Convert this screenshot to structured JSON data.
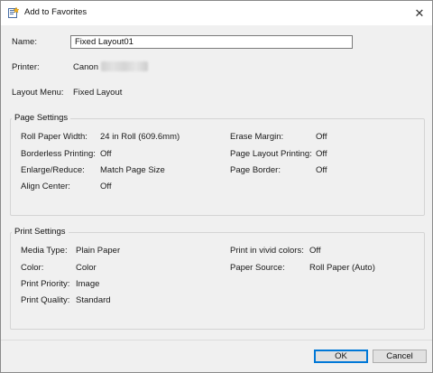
{
  "window": {
    "title": "Add to Favorites",
    "close_glyph": "✕",
    "icon": "favorites-icon"
  },
  "name": {
    "label": "Name:",
    "value": "Fixed Layout01"
  },
  "printer": {
    "label": "Printer:",
    "value": "Canon"
  },
  "layout_menu": {
    "label": "Layout Menu:",
    "value": "Fixed Layout"
  },
  "page_settings": {
    "title": "Page Settings",
    "roll_paper_width": {
      "label": "Roll Paper Width:",
      "value": "24 in Roll (609.6mm)"
    },
    "borderless_printing": {
      "label": "Borderless Printing:",
      "value": "Off"
    },
    "enlarge_reduce": {
      "label": "Enlarge/Reduce:",
      "value": "Match Page Size"
    },
    "align_center": {
      "label": "Align Center:",
      "value": "Off"
    },
    "erase_margin": {
      "label": "Erase Margin:",
      "value": "Off"
    },
    "page_layout_printing": {
      "label": "Page Layout Printing:",
      "value": "Off"
    },
    "page_border": {
      "label": "Page Border:",
      "value": "Off"
    }
  },
  "print_settings": {
    "title": "Print Settings",
    "media_type": {
      "label": "Media Type:",
      "value": "Plain Paper"
    },
    "color": {
      "label": "Color:",
      "value": "Color"
    },
    "print_priority": {
      "label": "Print Priority:",
      "value": "Image"
    },
    "print_quality": {
      "label": "Print Quality:",
      "value": "Standard"
    },
    "vivid_colors": {
      "label": "Print in vivid colors:",
      "value": "Off"
    },
    "paper_source": {
      "label": "Paper Source:",
      "value": "Roll Paper (Auto)"
    }
  },
  "buttons": {
    "ok": "OK",
    "cancel": "Cancel"
  },
  "colors": {
    "accent": "#0078d7",
    "dialog_bg": "#f0f0f0",
    "border": "#d4d4d4"
  }
}
